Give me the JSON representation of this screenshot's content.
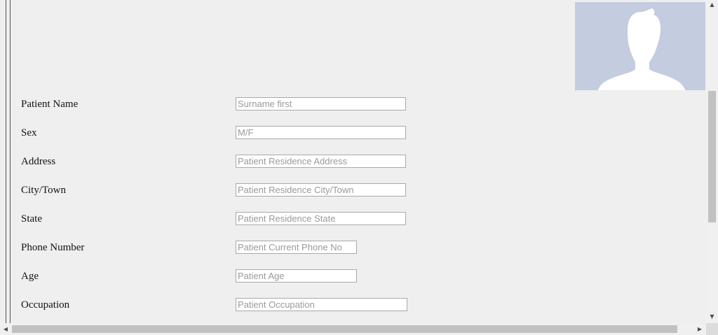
{
  "avatar": {
    "icon": "person-silhouette-icon",
    "background_color": "#c4cce0",
    "silhouette_color": "#ffffff"
  },
  "form": {
    "fields": [
      {
        "label": "Patient Name",
        "placeholder": "Surname first"
      },
      {
        "label": "Sex",
        "placeholder": "M/F"
      },
      {
        "label": "Address",
        "placeholder": "Patient Residence Address"
      },
      {
        "label": "City/Town",
        "placeholder": "Patient Residence City/Town"
      },
      {
        "label": "State",
        "placeholder": "Patient Residence State"
      },
      {
        "label": "Phone Number",
        "placeholder": "Patient Current Phone No"
      },
      {
        "label": "Age",
        "placeholder": "Patient Age"
      },
      {
        "label": "Occupation",
        "placeholder": "Patient Occupation"
      }
    ]
  },
  "scrollbars": {
    "vertical_up_icon": "arrow-up-icon",
    "vertical_down_icon": "arrow-down-icon",
    "horizontal_left_icon": "arrow-left-icon",
    "horizontal_right_icon": "arrow-right-icon"
  }
}
